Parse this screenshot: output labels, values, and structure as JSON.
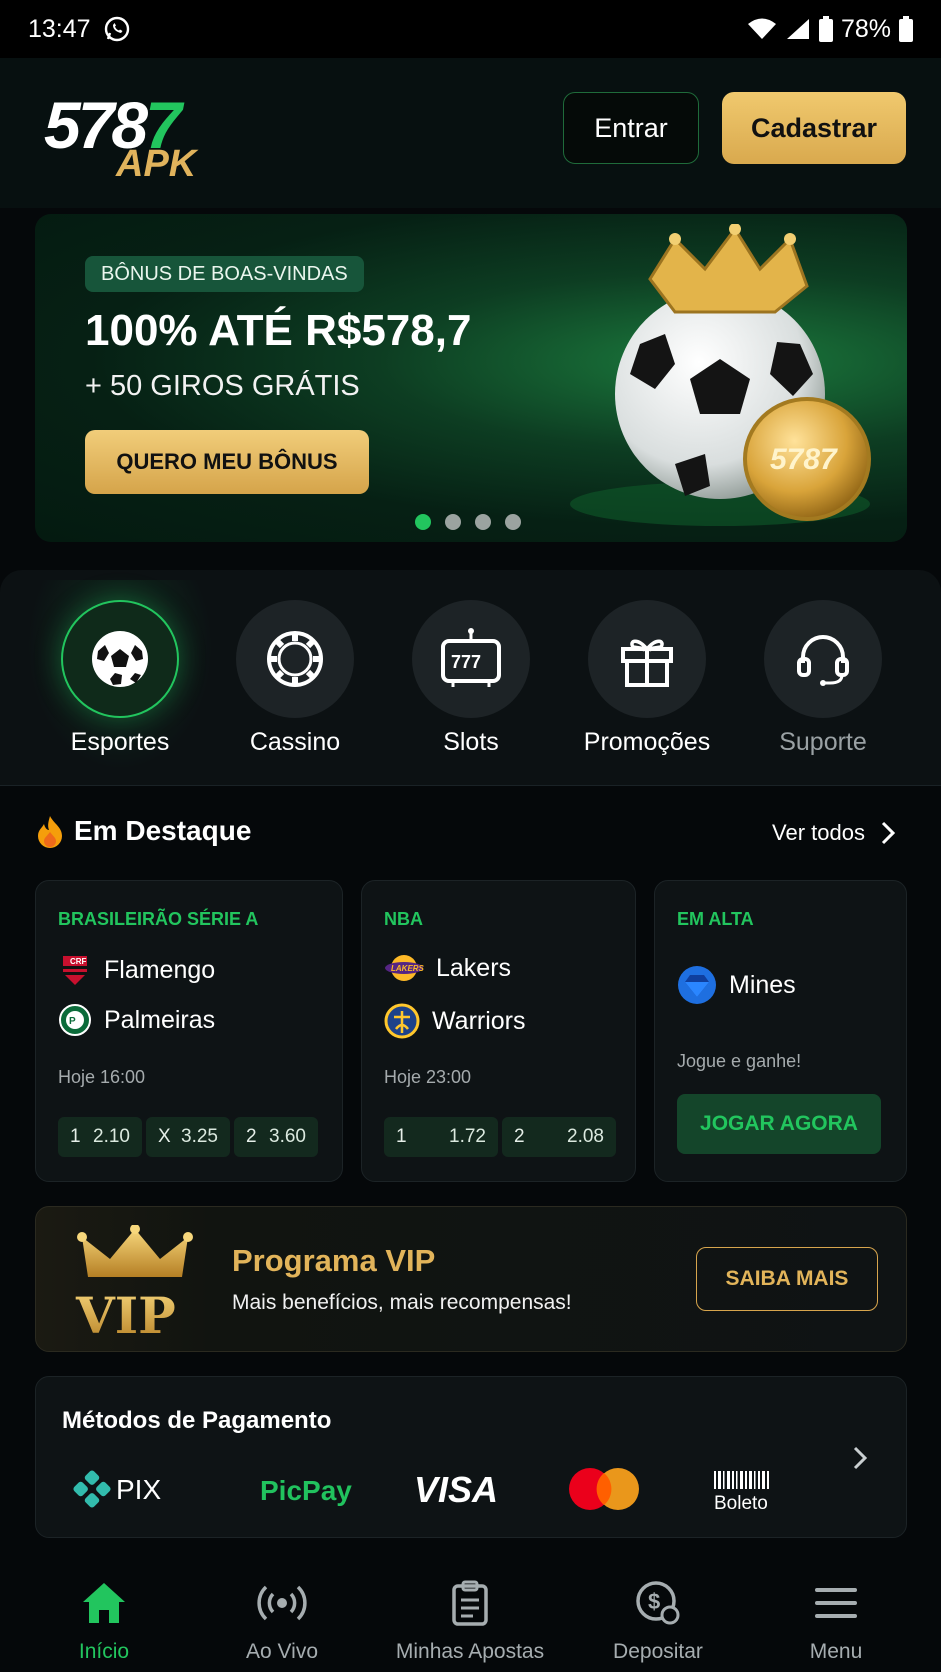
{
  "status_bar": {
    "time": "13:47",
    "battery": "78%"
  },
  "header": {
    "logo_number": "5787",
    "logo_suffix": "APK",
    "login_label": "Entrar",
    "signup_label": "Cadastrar"
  },
  "banner": {
    "badge": "BÔNUS DE BOAS-VINDAS",
    "headline": "100% ATÉ R$578,7",
    "subline": "+ 50 GIROS GRÁTIS",
    "cta": "QUERO MEU BÔNUS",
    "coin_text": "5787",
    "slides": 4,
    "active_slide": 1
  },
  "categories": [
    {
      "label": "Esportes",
      "icon": "soccer-ball-icon",
      "active": true
    },
    {
      "label": "Cassino",
      "icon": "casino-chip-icon",
      "active": false
    },
    {
      "label": "Slots",
      "icon": "slot-machine-icon",
      "active": false
    },
    {
      "label": "Promoções",
      "icon": "gift-icon",
      "active": false
    },
    {
      "label": "Suporte",
      "icon": "headset-icon",
      "active": false
    }
  ],
  "featured": {
    "title": "Em Destaque",
    "see_all": "Ver todos",
    "cards": [
      {
        "league": "BRASILEIRÃO SÉRIE A",
        "team1": "Flamengo",
        "team2": "Palmeiras",
        "time": "Hoje 16:00",
        "odds": [
          {
            "k": "1",
            "v": "2.10"
          },
          {
            "k": "X",
            "v": "3.25"
          },
          {
            "k": "2",
            "v": "3.60"
          }
        ]
      },
      {
        "league": "NBA",
        "team1": "Lakers",
        "team2": "Warriors",
        "time": "Hoje 23:00",
        "odds": [
          {
            "k": "1",
            "v": "1.72"
          },
          {
            "k": "2",
            "v": "2.08"
          }
        ]
      },
      {
        "league": "EM ALTA",
        "game": "Mines",
        "desc": "Jogue e ganhe!",
        "cta": "JOGAR AGORA"
      }
    ]
  },
  "vip": {
    "title": "Programa VIP",
    "subtitle": "Mais benefícios, mais recompensas!",
    "cta": "SAIBA MAIS",
    "badge_text": "VIP"
  },
  "payments": {
    "title": "Métodos de Pagamento",
    "methods": [
      "PIX",
      "PicPay",
      "VISA",
      "Mastercard",
      "Boleto"
    ]
  },
  "bottom_nav": [
    {
      "label": "Início",
      "icon": "home-icon",
      "active": true
    },
    {
      "label": "Ao Vivo",
      "icon": "live-broadcast-icon",
      "active": false
    },
    {
      "label": "Minhas Apostas",
      "icon": "clipboard-icon",
      "active": false
    },
    {
      "label": "Depositar",
      "icon": "deposit-coin-icon",
      "active": false
    },
    {
      "label": "Menu",
      "icon": "hamburger-menu-icon",
      "active": false
    }
  ],
  "colors": {
    "accent_green": "#22c55e",
    "gold": "#e0b35c",
    "background": "#05080a"
  }
}
